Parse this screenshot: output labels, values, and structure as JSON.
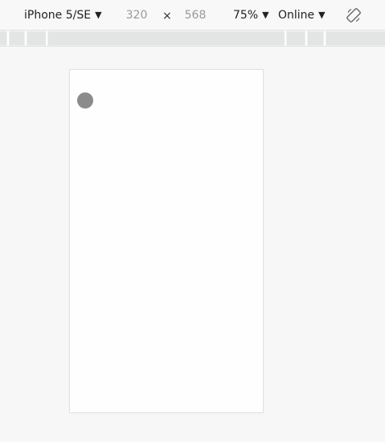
{
  "toolbar": {
    "device_label": "iPhone 5/SE",
    "width_value": "320",
    "times_symbol": "×",
    "height_value": "568",
    "zoom_label": "75%",
    "network_label": "Online",
    "caret_glyph": "▼",
    "rotate_icon": "rotate-icon"
  },
  "viewport": {
    "caption": "",
    "dot_color": "#8b8b8b"
  }
}
